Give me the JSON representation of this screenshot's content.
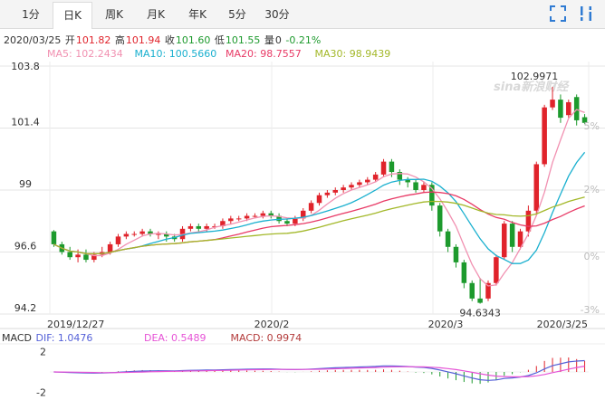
{
  "tabs": [
    {
      "label": "1分",
      "active": false
    },
    {
      "label": "日K",
      "active": true
    },
    {
      "label": "周K",
      "active": false
    },
    {
      "label": "月K",
      "active": false
    },
    {
      "label": "年K",
      "active": false
    },
    {
      "label": "5分",
      "active": false
    },
    {
      "label": "30分",
      "active": false
    }
  ],
  "tools": {
    "expand": "fullscreen-icon",
    "settings": "settings-icon"
  },
  "quote": {
    "date": "2020/03/25",
    "open_label": "开",
    "open": "101.82",
    "high_label": "高",
    "high": "101.94",
    "close_label": "收",
    "close": "101.60",
    "low_label": "低",
    "low": "101.55",
    "volume_label": "量",
    "volume": "0",
    "change": "-0.21%"
  },
  "ma": {
    "ma5": "MA5: 102.2434",
    "ma10": "MA10: 100.5660",
    "ma20": "MA20: 98.7557",
    "ma30": "MA30: 98.9439"
  },
  "macd_info": {
    "label": "MACD",
    "dif": "DIF: 1.0476",
    "dea": "DEA: 0.5489",
    "macd": "MACD: 0.9974"
  },
  "watermark": "sina新浪财经",
  "colors": {
    "up": "#e0232b",
    "down": "#1d9a2d",
    "ma5": "#f191b1",
    "ma10": "#1ab0cf",
    "ma20": "#e83a66",
    "ma30": "#a3b829",
    "dif": "#5561d8",
    "dea": "#e653d6",
    "macd_label": "#b33b3b"
  },
  "chart_data": {
    "type": "candlestick",
    "y_ticks": [
      "103.8",
      "101.4",
      "99",
      "96.6",
      "94.2"
    ],
    "y_range": [
      94.2,
      103.8
    ],
    "pct_ticks": [
      "5%",
      "2%",
      "0%",
      "-3%"
    ],
    "x_ticks": [
      "2019/12/27",
      "2020/2",
      "2020/3",
      "2020/3/25"
    ],
    "max_label": "102.9971",
    "min_label": "94.6343",
    "candles": [
      [
        97.4,
        96.9,
        97.45,
        96.8
      ],
      [
        96.9,
        96.6,
        97.0,
        96.5
      ],
      [
        96.6,
        96.4,
        96.8,
        96.3
      ],
      [
        96.4,
        96.5,
        96.7,
        96.2
      ],
      [
        96.5,
        96.3,
        96.7,
        96.2
      ],
      [
        96.3,
        96.5,
        96.6,
        96.2
      ],
      [
        96.5,
        96.6,
        96.8,
        96.4
      ],
      [
        96.6,
        96.9,
        97.0,
        96.5
      ],
      [
        96.9,
        97.2,
        97.3,
        96.8
      ],
      [
        97.2,
        97.3,
        97.4,
        97.1
      ],
      [
        97.3,
        97.3,
        97.4,
        97.2
      ],
      [
        97.3,
        97.4,
        97.5,
        97.2
      ],
      [
        97.4,
        97.3,
        97.5,
        97.2
      ],
      [
        97.3,
        97.3,
        97.4,
        97.1
      ],
      [
        97.3,
        97.2,
        97.4,
        97.0
      ],
      [
        97.2,
        97.1,
        97.3,
        97.0
      ],
      [
        97.1,
        97.5,
        97.6,
        97.0
      ],
      [
        97.5,
        97.6,
        97.7,
        97.4
      ],
      [
        97.6,
        97.5,
        97.7,
        97.4
      ],
      [
        97.5,
        97.6,
        97.7,
        97.4
      ],
      [
        97.6,
        97.6,
        97.7,
        97.5
      ],
      [
        97.6,
        97.8,
        97.9,
        97.5
      ],
      [
        97.8,
        97.9,
        98.0,
        97.7
      ],
      [
        97.9,
        97.9,
        98.0,
        97.8
      ],
      [
        97.9,
        98.0,
        98.1,
        97.8
      ],
      [
        98.0,
        98.0,
        98.1,
        97.9
      ],
      [
        98.0,
        98.1,
        98.2,
        97.9
      ],
      [
        98.1,
        98.0,
        98.2,
        97.9
      ],
      [
        98.0,
        97.8,
        98.1,
        97.7
      ],
      [
        97.8,
        97.7,
        97.9,
        97.6
      ],
      [
        97.7,
        97.9,
        98.0,
        97.6
      ],
      [
        97.9,
        98.2,
        98.3,
        97.8
      ],
      [
        98.2,
        98.5,
        98.6,
        98.1
      ],
      [
        98.5,
        98.8,
        98.9,
        98.4
      ],
      [
        98.8,
        98.9,
        99.0,
        98.7
      ],
      [
        98.9,
        99.0,
        99.1,
        98.8
      ],
      [
        99.0,
        99.1,
        99.2,
        98.9
      ],
      [
        99.1,
        99.2,
        99.3,
        99.0
      ],
      [
        99.2,
        99.3,
        99.4,
        99.1
      ],
      [
        99.3,
        99.4,
        99.5,
        99.2
      ],
      [
        99.4,
        99.6,
        99.7,
        99.3
      ],
      [
        99.6,
        100.1,
        100.2,
        99.5
      ],
      [
        100.1,
        99.7,
        100.2,
        99.5
      ],
      [
        99.7,
        99.4,
        99.8,
        99.2
      ],
      [
        99.4,
        99.3,
        99.5,
        99.1
      ],
      [
        99.3,
        99.0,
        99.4,
        98.9
      ],
      [
        99.0,
        99.2,
        99.3,
        98.9
      ],
      [
        99.2,
        98.4,
        99.3,
        98.2
      ],
      [
        98.4,
        97.4,
        98.5,
        97.2
      ],
      [
        97.4,
        96.8,
        97.5,
        96.6
      ],
      [
        96.8,
        96.2,
        96.9,
        96.0
      ],
      [
        96.2,
        95.4,
        96.3,
        95.2
      ],
      [
        95.4,
        94.8,
        95.5,
        94.7
      ],
      [
        94.8,
        94.6343,
        95.6,
        94.6
      ],
      [
        94.8,
        95.4,
        95.5,
        94.7
      ],
      [
        95.4,
        96.4,
        96.5,
        95.3
      ],
      [
        96.4,
        97.7,
        97.8,
        96.3
      ],
      [
        97.7,
        96.8,
        97.8,
        96.6
      ],
      [
        96.8,
        97.4,
        97.5,
        96.7
      ],
      [
        97.4,
        98.2,
        98.4,
        97.2
      ],
      [
        98.2,
        100.0,
        100.1,
        98.0
      ],
      [
        100.0,
        102.2,
        102.3,
        99.9
      ],
      [
        102.2,
        102.5,
        102.9971,
        102.1
      ],
      [
        102.5,
        101.8,
        102.7,
        101.6
      ],
      [
        101.9,
        102.4,
        102.5,
        101.8
      ],
      [
        102.6,
        101.7,
        102.7,
        101.5
      ],
      [
        101.82,
        101.6,
        101.94,
        101.55
      ]
    ],
    "macd_ticks": [
      "2",
      "-2"
    ],
    "macd_range": [
      -2.2,
      2.2
    ]
  }
}
